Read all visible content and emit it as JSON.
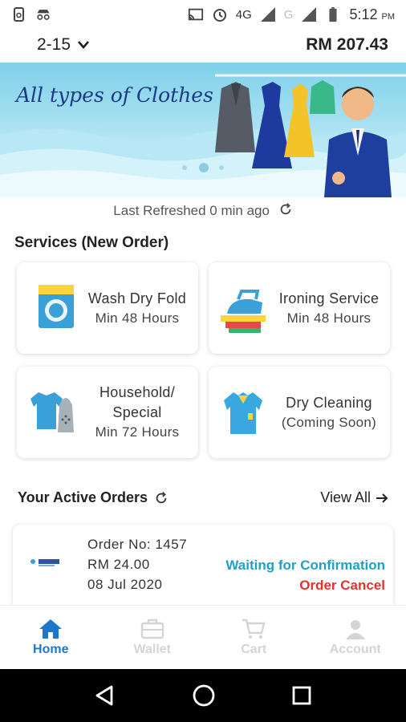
{
  "status_bar": {
    "time": "5:12",
    "ampm": "PM",
    "network": "4G",
    "network2": "G"
  },
  "header": {
    "selector": "2-15",
    "balance": "RM 207.43"
  },
  "banner": {
    "title": "All types of Clothes"
  },
  "refresh": {
    "text": "Last Refreshed 0 min ago"
  },
  "services": {
    "title": "Services (New Order)",
    "items": [
      {
        "name": "Wash Dry Fold",
        "sub": "Min 48 Hours"
      },
      {
        "name": "Ironing Service",
        "sub": "Min 48 Hours"
      },
      {
        "name": "Household/ Special",
        "sub": "Min 72 Hours"
      },
      {
        "name": "Dry Cleaning",
        "sub": "(Coming Soon)"
      }
    ]
  },
  "active_orders": {
    "title": "Your Active Orders",
    "view_all": "View All"
  },
  "order": {
    "number": "Order No: 1457",
    "amount": "RM 24.00",
    "date": "08 Jul 2020",
    "status": "Waiting for Confirmation",
    "cancel": "Order Cancel"
  },
  "tabs": [
    {
      "label": "Home"
    },
    {
      "label": "Wallet"
    },
    {
      "label": "Cart"
    },
    {
      "label": "Account"
    }
  ],
  "colors": {
    "accent": "#1c78c8",
    "status": "#1fa1c6",
    "cancel": "#e0352b"
  }
}
